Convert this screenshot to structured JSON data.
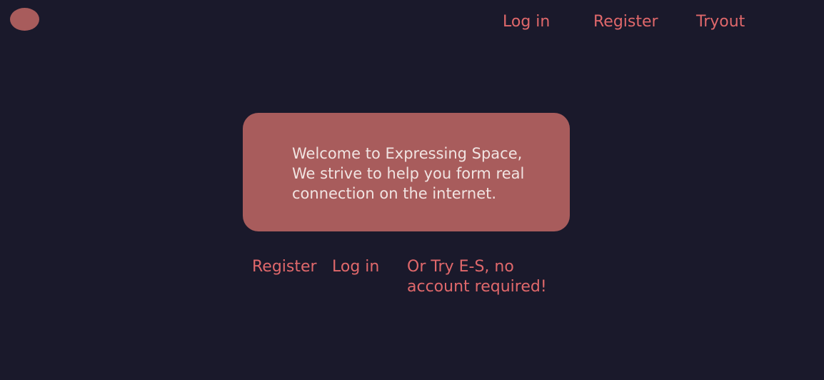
{
  "header": {
    "logo": "logo-icon",
    "nav": {
      "login_label": "Log in",
      "register_label": "Register",
      "tryout_label": "Tryout"
    }
  },
  "main": {
    "welcome": "Welcome to Expressing Space,\nWe strive to help you form real connection on the internet.",
    "actions": {
      "register_label": "Register",
      "login_label": "Log in",
      "try_label": "Or Try E-S, no account required!"
    }
  },
  "colors": {
    "background": "#1a192b",
    "accent": "#a85c5c",
    "link": "#e0686b",
    "card_text": "#f1e4e2"
  }
}
